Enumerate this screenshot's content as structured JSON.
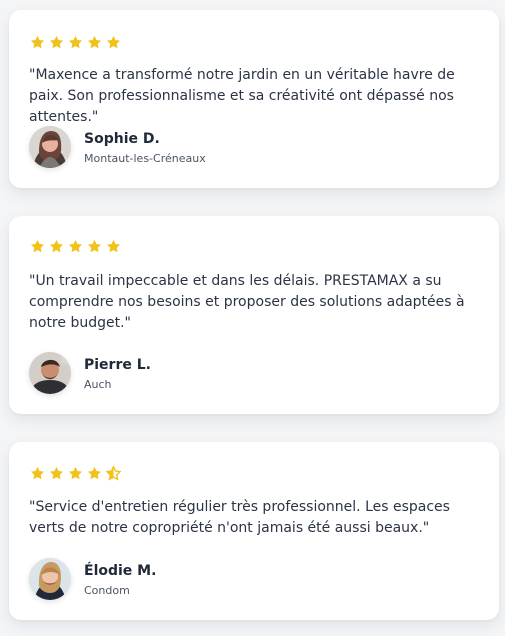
{
  "colors": {
    "star": "#f2c21b",
    "card_background": "#ffffff",
    "page_background": "#f3f5f7",
    "text": "#2b3445"
  },
  "testimonials": [
    {
      "rating": 5,
      "quote": "\"Maxence a transformé notre jardin en un véritable havre de paix. Son professionnalisme et sa créativité ont dépassé nos attentes.\"",
      "name": "Sophie D.",
      "location": "Montaut-les-Créneaux",
      "avatar_icon": "woman-avatar-icon"
    },
    {
      "rating": 5,
      "quote": "\"Un travail impeccable et dans les délais. PRESTAMAX a su comprendre nos besoins et proposer des solutions adaptées à notre budget.\"",
      "name": "Pierre L.",
      "location": "Auch",
      "avatar_icon": "man-avatar-icon"
    },
    {
      "rating": 4.5,
      "quote": "\"Service d'entretien régulier très professionnel. Les espaces verts de notre copropriété n'ont jamais été aussi beaux.\"",
      "name": "Élodie M.",
      "location": "Condom",
      "avatar_icon": "woman-avatar-icon"
    }
  ]
}
